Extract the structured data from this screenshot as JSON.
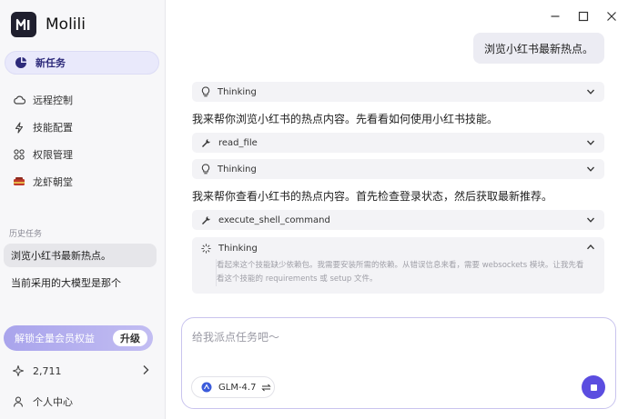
{
  "app": {
    "name": "Molili"
  },
  "sidebar": {
    "new_task": "新任务",
    "items": [
      {
        "label": "远程控制",
        "icon": "cloud-icon"
      },
      {
        "label": "技能配置",
        "icon": "bolt-icon"
      },
      {
        "label": "权限管理",
        "icon": "apps-icon"
      },
      {
        "label": "龙虾朝堂",
        "icon": "lobster-icon"
      }
    ],
    "history_label": "历史任务",
    "history": [
      {
        "label": "浏览小红书最新热点。",
        "active": true
      },
      {
        "label": "当前采用的大模型是那个",
        "active": false
      }
    ],
    "upgrade": {
      "text": "解锁全量会员权益",
      "button": "升级"
    },
    "points": "2,711",
    "profile": "个人中心"
  },
  "chat": {
    "user_message": "浏览小红书最新热点。",
    "thinking_label": "Thinking",
    "assistant_1": "我来帮你浏览小红书的热点内容。先看看如何使用小红书技能。",
    "tool_1": "read_file",
    "assistant_2": "我来帮你查看小红书的热点内容。首先检查登录状态，然后获取最新推荐。",
    "tool_2": "execute_shell_command",
    "thinking_expanded_line1": "看起来这个技能缺少依赖包。我需要安装所需的依赖。从错误信息来看，需要 websockets 模块。让我先看",
    "thinking_expanded_line2": "看这个技能的 requirements 或 setup 文件。"
  },
  "composer": {
    "placeholder": "给我派点任务吧～",
    "model": "GLM-4.7"
  },
  "colors": {
    "accent": "#5b4de0",
    "sidebar_bg": "#f7f7f9"
  }
}
